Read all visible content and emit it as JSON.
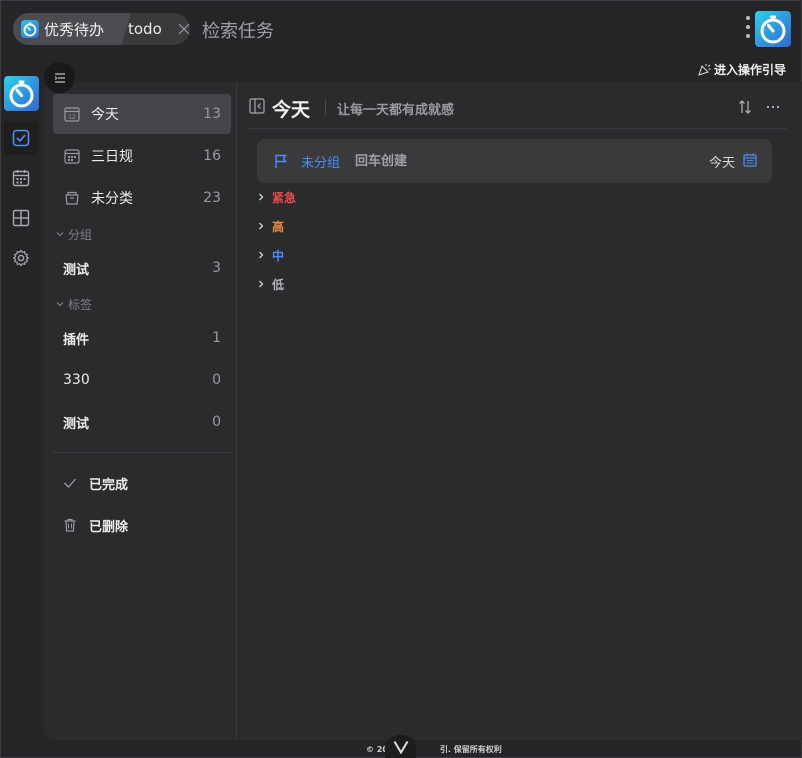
{
  "window": {
    "app_tab_label": "优秀待办",
    "query_tab_label": "todo",
    "search_label": "检索任务"
  },
  "header_actions": {
    "guide_label": "进入操作引导"
  },
  "sidebar": {
    "smart_lists": [
      {
        "label": "今天",
        "count": "13",
        "icon": "calendar-12-icon"
      },
      {
        "label": "三日规",
        "count": "16",
        "icon": "calendar-icon"
      },
      {
        "label": "未分类",
        "count": "23",
        "icon": "inbox-icon"
      }
    ],
    "groups_heading": "分组",
    "groups": [
      {
        "label": "测试",
        "count": "3"
      }
    ],
    "tags_heading": "标签",
    "tags": [
      {
        "label": "插件",
        "count": "1"
      },
      {
        "label": "330",
        "count": "0"
      },
      {
        "label": "测试",
        "count": "0"
      }
    ],
    "completed_label": "已完成",
    "deleted_label": "已删除"
  },
  "content": {
    "title": "今天",
    "subtitle": "让每一天都有成就感",
    "create_bar": {
      "group": "未分组",
      "placeholder": "回车创建",
      "date": "今天"
    },
    "priorities": [
      {
        "label": "紧急",
        "color": "#e84b4b"
      },
      {
        "label": "高",
        "color": "#f08a3c"
      },
      {
        "label": "中",
        "color": "#4c8df0"
      },
      {
        "label": "低",
        "color": "#b4b4b8"
      }
    ]
  },
  "footer": {
    "left": "© 20",
    "right": "引. 保留所有权利"
  },
  "colors": {
    "accent": "#4c8df0",
    "background": "#252528",
    "panel": "#2b2b2e"
  }
}
